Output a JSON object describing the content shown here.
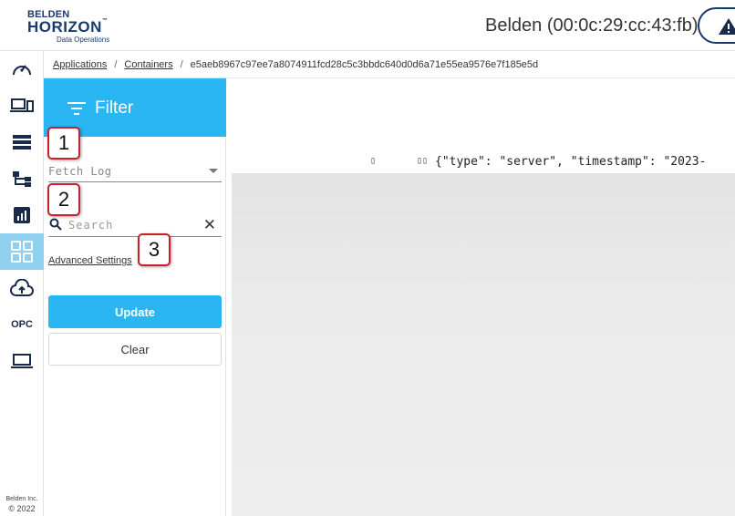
{
  "header": {
    "logo": {
      "brand_top": "BELDEN",
      "brand_main": "HORIZON",
      "trademark": "™",
      "brand_sub": "Data Operations"
    },
    "device_name": "Belden (00:0c:29:cc:43:fb)",
    "alert_icon": "warning-icon"
  },
  "sidebar": {
    "items": [
      {
        "icon": "dashboard-gauge-icon",
        "active": false
      },
      {
        "icon": "devices-icon",
        "active": false
      },
      {
        "icon": "servers-list-icon",
        "active": false
      },
      {
        "icon": "topology-icon",
        "active": false
      },
      {
        "icon": "bar-chart-icon",
        "active": false
      },
      {
        "icon": "applications-grid-icon",
        "active": true
      },
      {
        "icon": "cloud-upload-icon",
        "active": false
      },
      {
        "label": "OPC",
        "active": false
      },
      {
        "icon": "laptop-icon",
        "active": false
      }
    ],
    "footer": {
      "company": "Belden Inc.",
      "year": "© 2022"
    }
  },
  "breadcrumb": {
    "items": [
      "Applications",
      "Containers"
    ],
    "current": "e5aeb8967c97ee7a8074911fcd28c5c3bbdc640d0d6a71e55ea9576e7f185e5d",
    "separator": "/"
  },
  "filter": {
    "title": "Filter",
    "fetch_log": {
      "placeholder": "Fetch Log"
    },
    "search": {
      "placeholder": "Search",
      "value": ""
    },
    "advanced_settings_label": "Advanced Settings",
    "update_label": "Update",
    "clear_label": "Clear"
  },
  "callouts": [
    "1",
    "2",
    "3"
  ],
  "log": {
    "glyph_single": "▯",
    "glyph_double": "▯▯",
    "first_line": "{\"type\": \"server\", \"timestamp\": \"2023-"
  },
  "colors": {
    "accent": "#29b6f2",
    "active_nav": "#8fd1ee",
    "brand_navy": "#1a3a6b",
    "callout_border": "#c8202c"
  }
}
